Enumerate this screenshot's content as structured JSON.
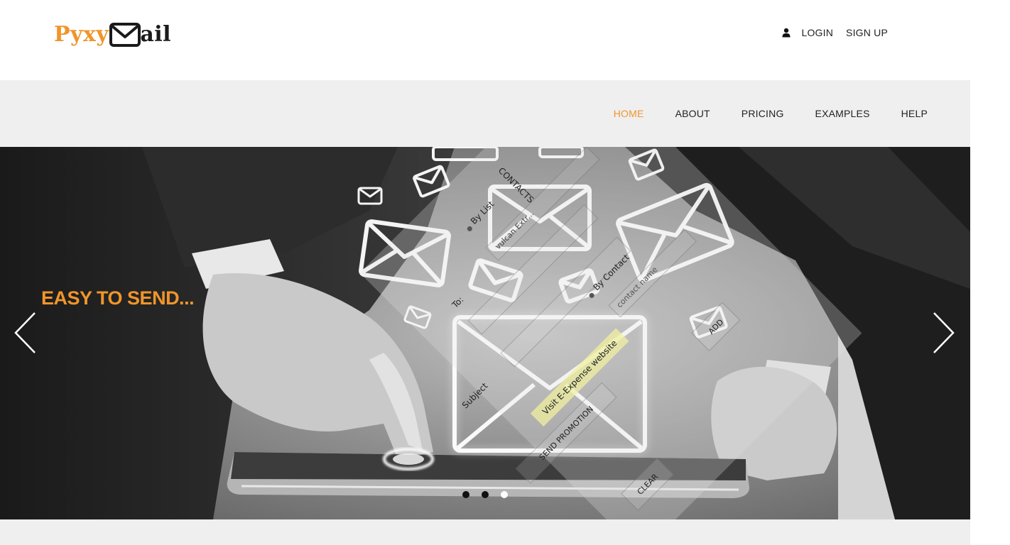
{
  "brand": {
    "logo_part1": "Pyxy",
    "logo_part2": "ail"
  },
  "header": {
    "login_label": "LOGIN",
    "signup_label": "SIGN UP"
  },
  "nav": {
    "items": [
      "HOME",
      "ABOUT",
      "PRICING",
      "EXAMPLES",
      "HELP"
    ],
    "active": "HOME"
  },
  "hero": {
    "caption": "EASY TO SEND...",
    "slides_count": 3,
    "active_slide": 3,
    "overlay": {
      "contacts_label": "CONTACTS",
      "by_list_label": "By List",
      "to_label": "To:",
      "vulcan_text": "vulcan Extr...",
      "subject_label": "Subject",
      "by_contact_label": "By Contact",
      "contact_name_placeholder": "contact name",
      "visit_label": "Visit E-Expense website",
      "send_promotion_label": "SEND PROMOTION",
      "add_label": "ADD",
      "clear_label": "CLEAR"
    }
  },
  "colors": {
    "accent": "#f0952b",
    "nav_band": "#efefef",
    "text": "#222222"
  },
  "icons": {
    "user": "user-icon",
    "prev": "chevron-left-icon",
    "next": "chevron-right-icon",
    "logo_envelope": "envelope-icon"
  }
}
